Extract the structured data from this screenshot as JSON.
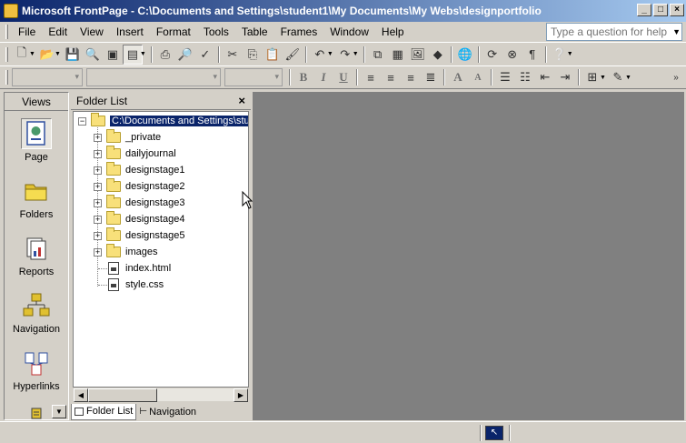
{
  "window": {
    "title": "Microsoft FrontPage - C:\\Documents and Settings\\student1\\My Documents\\My Webs\\designportfolio",
    "minimize": "_",
    "maximize": "□",
    "close": "×"
  },
  "menu": {
    "items": [
      "File",
      "Edit",
      "View",
      "Insert",
      "Format",
      "Tools",
      "Table",
      "Frames",
      "Window",
      "Help"
    ]
  },
  "help_search": {
    "placeholder": "Type a question for help"
  },
  "views": {
    "header": "Views",
    "items": [
      {
        "label": "Page",
        "icon": "page-view-icon",
        "selected": true
      },
      {
        "label": "Folders",
        "icon": "folders-view-icon",
        "selected": false
      },
      {
        "label": "Reports",
        "icon": "reports-view-icon",
        "selected": false
      },
      {
        "label": "Navigation",
        "icon": "navigation-view-icon",
        "selected": false
      },
      {
        "label": "Hyperlinks",
        "icon": "hyperlinks-view-icon",
        "selected": false
      }
    ]
  },
  "folder_list": {
    "header": "Folder List",
    "close": "×",
    "root": "C:\\Documents and Settings\\stud",
    "folders": [
      "_private",
      "dailyjournal",
      "designstage1",
      "designstage2",
      "designstage3",
      "designstage4",
      "designstage5",
      "images"
    ],
    "files": [
      {
        "name": "index.html",
        "icon": "html-file-icon"
      },
      {
        "name": "style.css",
        "icon": "css-file-icon"
      }
    ],
    "tabs": [
      {
        "label": "Folder List",
        "active": true
      },
      {
        "label": "Navigation",
        "active": false
      }
    ]
  },
  "colors": {
    "titlebar_start": "#0a246a",
    "titlebar_end": "#a6caf0",
    "chrome": "#d4d0c8",
    "workspace": "#808080",
    "selection": "#0a246a"
  }
}
